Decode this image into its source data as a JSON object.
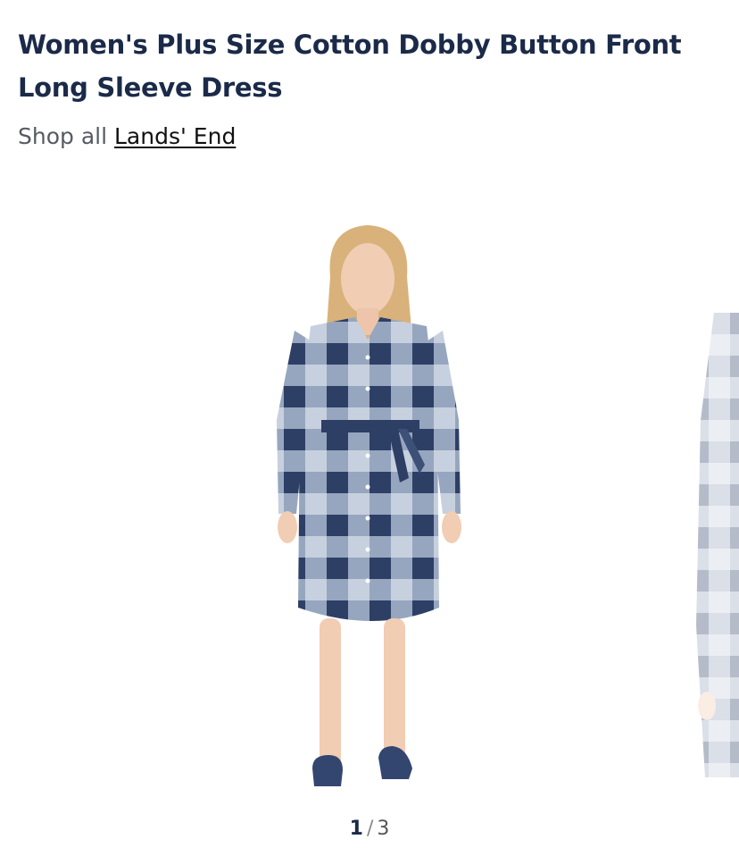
{
  "product": {
    "title": "Women's Plus Size Cotton Dobby Button Front Long Sleeve Dress",
    "shop_all_prefix": "Shop all",
    "brand": "Lands' End"
  },
  "gallery": {
    "current": "1",
    "separator": "/",
    "total": "3"
  },
  "colors": {
    "title": "#1b2a48",
    "plaid_dark": "#33466f",
    "plaid_light": "#b9c4d6"
  }
}
